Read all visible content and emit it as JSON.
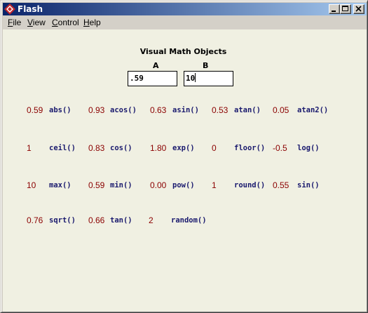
{
  "window": {
    "title": "Flash"
  },
  "menu": {
    "file": "File",
    "view": "View",
    "control": "Control",
    "help": "Help"
  },
  "panel": {
    "heading": "Visual Math Objects",
    "label_a": "A",
    "label_b": "B",
    "input_a": ".59",
    "input_b": "10"
  },
  "rows": [
    {
      "cells": [
        {
          "value": "0.59",
          "fn": "abs()"
        },
        {
          "value": "0.93",
          "fn": "acos()"
        },
        {
          "value": "0.63",
          "fn": "asin()"
        },
        {
          "value": "0.53",
          "fn": "atan()"
        },
        {
          "value": "0.05",
          "fn": "atan2()"
        }
      ]
    },
    {
      "cells": [
        {
          "value": "1",
          "fn": "ceil()"
        },
        {
          "value": "0.83",
          "fn": "cos()"
        },
        {
          "value": "1.80",
          "fn": "exp()"
        },
        {
          "value": "0",
          "fn": "floor()"
        },
        {
          "value": "-0.5",
          "fn": "log()"
        }
      ]
    },
    {
      "cells": [
        {
          "value": "10",
          "fn": "max()"
        },
        {
          "value": "0.59",
          "fn": "min()"
        },
        {
          "value": "0.00",
          "fn": "pow()"
        },
        {
          "value": "1",
          "fn": "round()"
        },
        {
          "value": "0.55",
          "fn": "sin()"
        }
      ]
    },
    {
      "cells": [
        {
          "value": "0.76",
          "fn": "sqrt()"
        },
        {
          "value": "0.66",
          "fn": "tan()"
        },
        {
          "value": "2",
          "fn": "random()"
        }
      ]
    }
  ]
}
